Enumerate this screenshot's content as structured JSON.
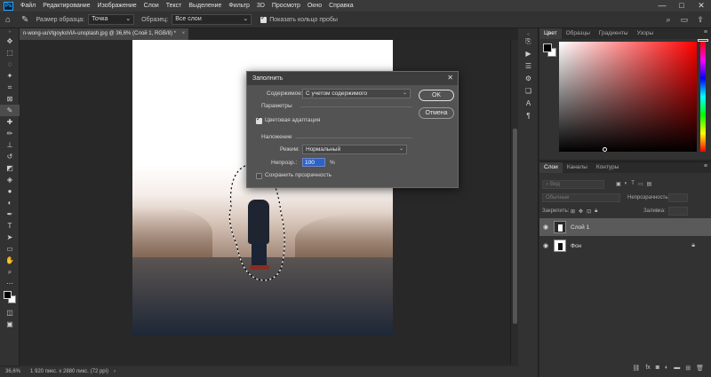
{
  "app": {
    "logo_text": "Ps"
  },
  "menubar": {
    "items": [
      "Файл",
      "Редактирование",
      "Изображение",
      "Слои",
      "Текст",
      "Выделение",
      "Фильтр",
      "3D",
      "Просмотр",
      "Окно",
      "Справка"
    ],
    "window_controls": [
      "—",
      "□",
      "✕"
    ]
  },
  "options": {
    "sample_size_label": "Размер образца:",
    "sample_size_value": "Точка",
    "sample_label": "Образец:",
    "sample_value": "Все слои",
    "show_ring_label": "Показать кольцо пробы"
  },
  "document": {
    "tab_title": "n-wong-uuVtgoykoViA-unsplash.jpg @ 36,6% (Слой 1, RGB/8) *",
    "tab_close": "×"
  },
  "status": {
    "zoom": "36,6%",
    "info": "1 920 пикс. x 2880 пикс. (72 ppi)",
    "arrow": "›"
  },
  "dialog": {
    "title": "Заполнить",
    "close": "✕",
    "content_label": "Содержимое:",
    "content_value": "С учетом содержимого",
    "ok_label": "OK",
    "cancel_label": "Отмена",
    "params_label": "Параметры",
    "color_adapt_label": "Цветовая адаптация",
    "color_adapt_checked": true,
    "overlay_label": "Наложение",
    "mode_label": "Режим:",
    "mode_value": "Нормальный",
    "opacity_label": "Непрозр.:",
    "opacity_value": "100",
    "opacity_unit": "%",
    "preserve_label": "Сохранить прозрачность",
    "preserve_checked": false
  },
  "color_panel": {
    "tabs": [
      "Цвет",
      "Образцы",
      "Градиенты",
      "Узоры"
    ],
    "active_tab": "Цвет",
    "menu": "≡",
    "hue": "#ff0000"
  },
  "layers_panel": {
    "tabs": [
      "Слои",
      "Каналы",
      "Контуры"
    ],
    "active_tab": "Слои",
    "menu": "≡",
    "search_placeholder": "Вид",
    "blend_mode": "Обычные",
    "opacity_label": "Непрозрачность:",
    "lock_label": "Закрепить:",
    "fill_label": "Заливка:",
    "layers": [
      {
        "name": "Слой 1",
        "selected": true
      },
      {
        "name": "Фон",
        "selected": false
      }
    ],
    "bottom_icons": [
      "link-icon",
      "fx-icon",
      "mask-icon",
      "adjustment-icon",
      "group-icon",
      "new-layer-icon",
      "trash-icon"
    ]
  }
}
